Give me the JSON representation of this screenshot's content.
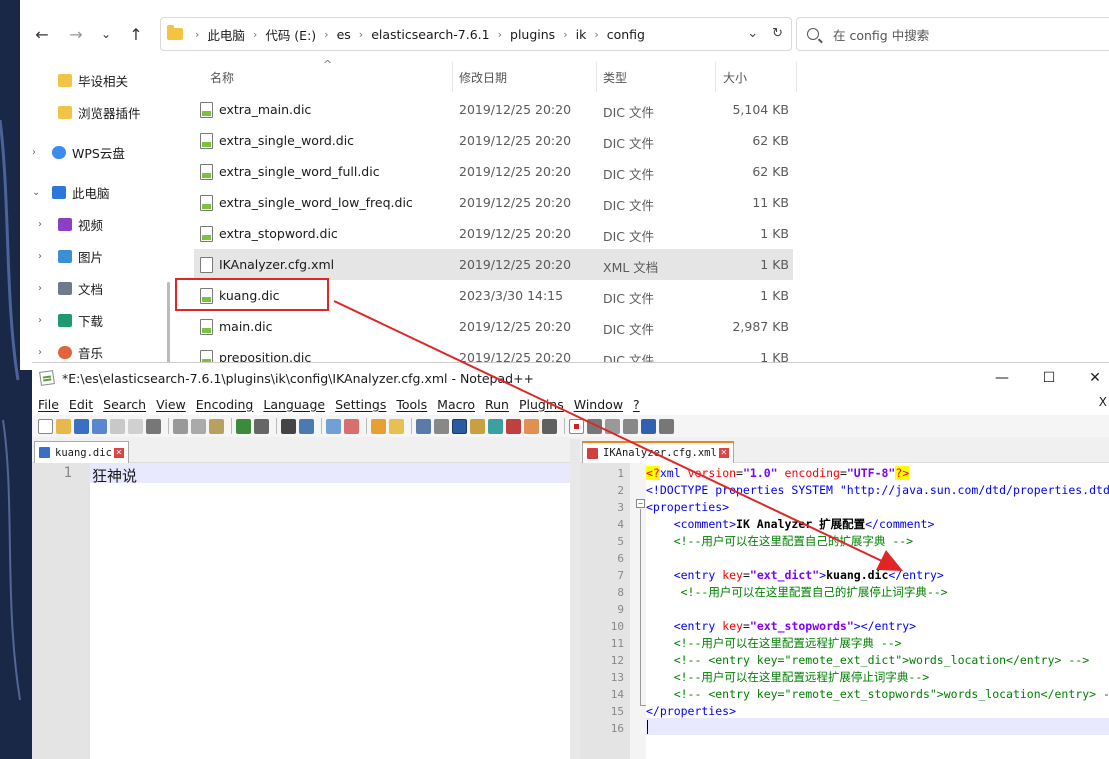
{
  "explorer": {
    "nav": {
      "back": "←",
      "forward": "→",
      "recent": "⌄",
      "up": "↑"
    },
    "breadcrumb": [
      "此电脑",
      "代码 (E:)",
      "es",
      "elasticsearch-7.6.1",
      "plugins",
      "ik",
      "config"
    ],
    "search_placeholder": "在 config 中搜索",
    "sidebar": [
      {
        "label": "毕设相关",
        "icon": "folder-icon"
      },
      {
        "label": "浏览器插件",
        "icon": "folder-icon"
      },
      {
        "label": "WPS云盘",
        "icon": "cloud-icon"
      },
      {
        "label": "此电脑",
        "icon": "computer-icon"
      },
      {
        "label": "视频",
        "icon": "video-icon"
      },
      {
        "label": "图片",
        "icon": "picture-icon"
      },
      {
        "label": "文档",
        "icon": "document-icon"
      },
      {
        "label": "下载",
        "icon": "download-icon"
      },
      {
        "label": "音乐",
        "icon": "music-icon"
      }
    ],
    "columns": {
      "name": "名称",
      "date": "修改日期",
      "type": "类型",
      "size": "大小"
    },
    "files": [
      {
        "name": "extra_main.dic",
        "date": "2019/12/25 20:20",
        "type": "DIC 文件",
        "size": "5,104 KB"
      },
      {
        "name": "extra_single_word.dic",
        "date": "2019/12/25 20:20",
        "type": "DIC 文件",
        "size": "62 KB"
      },
      {
        "name": "extra_single_word_full.dic",
        "date": "2019/12/25 20:20",
        "type": "DIC 文件",
        "size": "62 KB"
      },
      {
        "name": "extra_single_word_low_freq.dic",
        "date": "2019/12/25 20:20",
        "type": "DIC 文件",
        "size": "11 KB"
      },
      {
        "name": "extra_stopword.dic",
        "date": "2019/12/25 20:20",
        "type": "DIC 文件",
        "size": "1 KB"
      },
      {
        "name": "IKAnalyzer.cfg.xml",
        "date": "2019/12/25 20:20",
        "type": "XML 文档",
        "size": "1 KB"
      },
      {
        "name": "kuang.dic",
        "date": "2023/3/30 14:15",
        "type": "DIC 文件",
        "size": "1 KB"
      },
      {
        "name": "main.dic",
        "date": "2019/12/25 20:20",
        "type": "DIC 文件",
        "size": "2,987 KB"
      },
      {
        "name": "preposition.dic",
        "date": "2019/12/25 20:20",
        "type": "DIC 文件",
        "size": "1 KB"
      }
    ]
  },
  "npp": {
    "title": "*E:\\es\\elasticsearch-7.6.1\\plugins\\ik\\config\\IKAnalyzer.cfg.xml - Notepad++",
    "controls": {
      "minimize": "—",
      "maximize": "☐",
      "close": "✕"
    },
    "menus": [
      "File",
      "Edit",
      "Search",
      "View",
      "Encoding",
      "Language",
      "Settings",
      "Tools",
      "Macro",
      "Run",
      "Plugins",
      "Window",
      "?"
    ],
    "menu_close": "X",
    "left_tab": "kuang.dic",
    "right_tab": "IKAnalyzer.cfg.xml",
    "left_lines": [
      "狂神说"
    ],
    "right_line_numbers": [
      "1",
      "2",
      "3",
      "4",
      "5",
      "6",
      "7",
      "8",
      "9",
      "10",
      "11",
      "12",
      "13",
      "14",
      "15",
      "16"
    ],
    "right_lines": [
      "<?xml version=\"1.0\" encoding=\"UTF-8\"?>",
      "<!DOCTYPE properties SYSTEM \"http://java.sun.com/dtd/properties.dtd\">",
      "<properties>",
      "    <comment>IK Analyzer 扩展配置</comment>",
      "    <!--用户可以在这里配置自己的扩展字典 -->",
      "",
      "    <entry key=\"ext_dict\">kuang.dic</entry>",
      "     <!--用户可以在这里配置自己的扩展停止词字典-->",
      "",
      "    <entry key=\"ext_stopwords\"></entry>",
      "    <!--用户可以在这里配置远程扩展字典 -->",
      "    <!-- <entry key=\"remote_ext_dict\">words_location</entry> -->",
      "    <!--用户可以在这里配置远程扩展停止词字典-->",
      "    <!-- <entry key=\"remote_ext_stopwords\">words_location</entry> -->",
      "</properties>",
      ""
    ]
  },
  "colors": {
    "highlight_box": "#e02525",
    "arrow": "#e02525",
    "selected_row": "#e5e5e5"
  }
}
